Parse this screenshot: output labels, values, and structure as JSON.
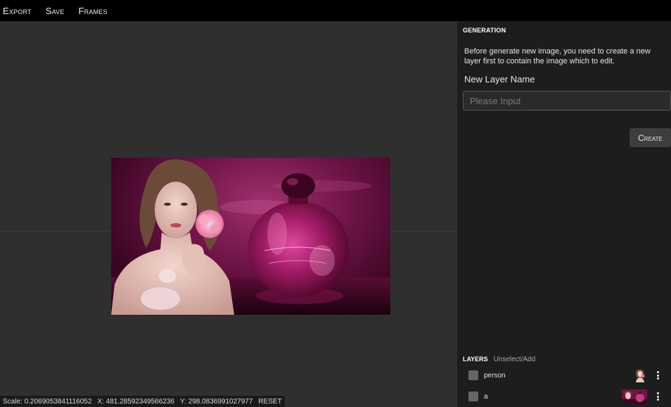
{
  "menubar": {
    "items": [
      {
        "id": "export",
        "label": "Export"
      },
      {
        "id": "save",
        "label": "Save"
      },
      {
        "id": "frames",
        "label": "Frames"
      }
    ]
  },
  "status": {
    "scale": "Scale: 0.2069053841116052",
    "x": "X: 481.28592349566236",
    "y": "Y: 298.0836991027977",
    "reset_label": "RESET"
  },
  "generation": {
    "title": "GENERATION",
    "description": "Before generate new image, you need to create a new layer first to contain the image which to edit.",
    "field_label": "New Layer Name",
    "input_value": "",
    "input_placeholder": "Please Input",
    "create_label": "Create"
  },
  "layers": {
    "title": "LAYERS",
    "unselect_label": "Unselect/Add",
    "items": [
      {
        "name": "person",
        "thumb_icon": "person-thumbnail"
      },
      {
        "name": "a",
        "thumb_icon": "perfume-ad-thumbnail"
      }
    ]
  },
  "colors": {
    "menubar_bg": "#000000",
    "canvas_bg": "#2f2f2f",
    "panel_bg": "#1d1d1d",
    "image_accent": "#8a1f5a"
  },
  "canvas_image": {
    "icon": "perfume-advertisement-image"
  }
}
